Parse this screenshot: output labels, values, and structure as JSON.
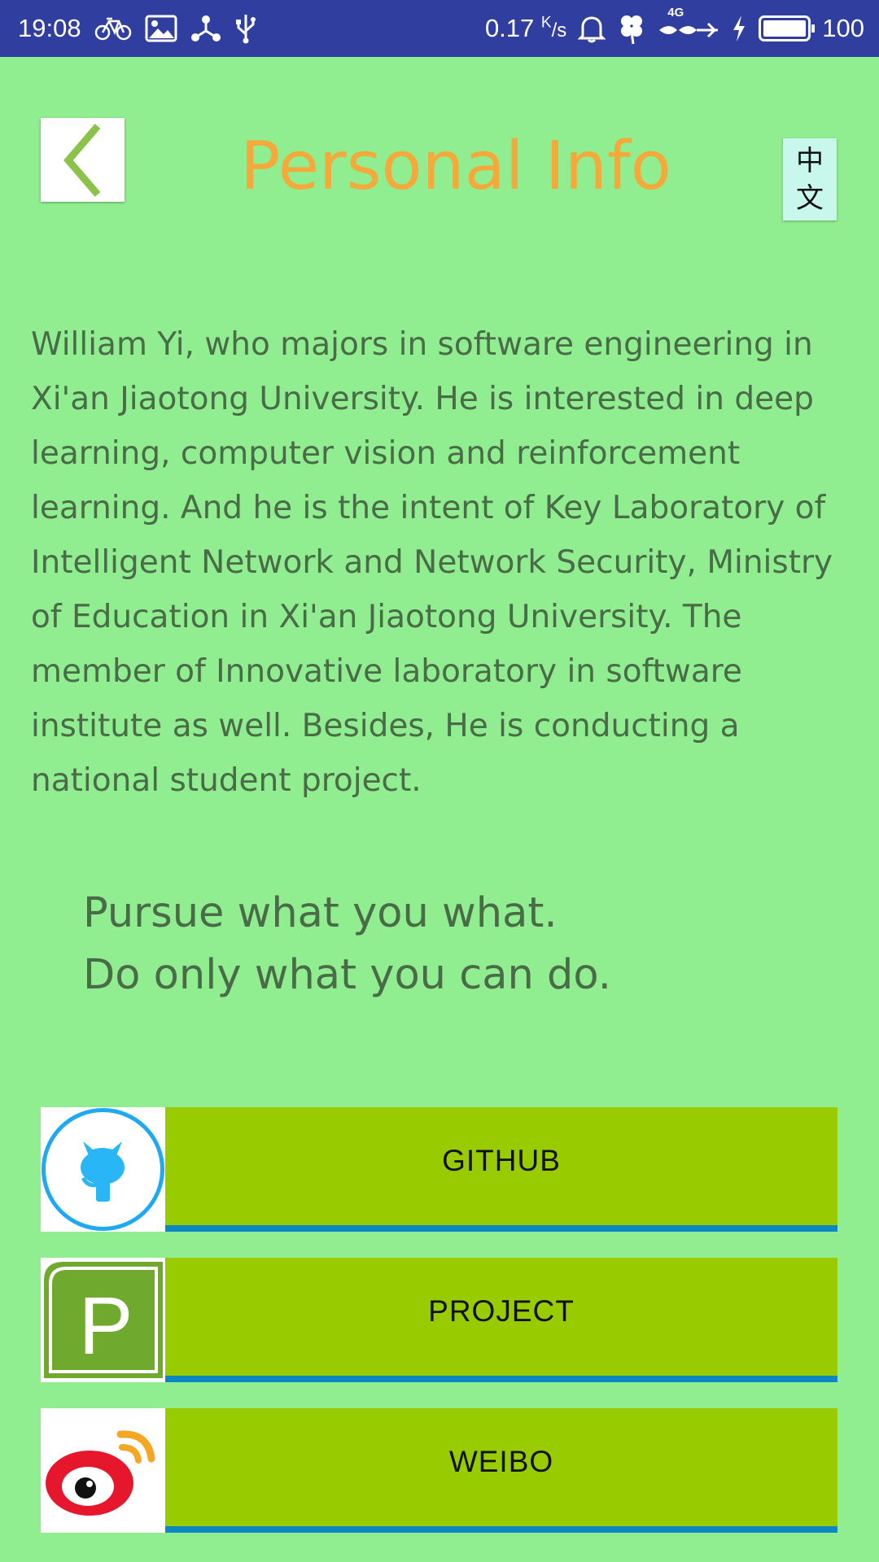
{
  "status_bar": {
    "time": "19:08",
    "net_speed": "0.17",
    "speed_unit_top": "K",
    "speed_unit_bottom": "/s",
    "network_type": "4G",
    "battery_level": "100"
  },
  "header": {
    "title": "Personal Info",
    "lang_char_1": "中",
    "lang_char_2": "文"
  },
  "bio": {
    "text": "William Yi, who majors in software engineering in Xi'an Jiaotong University. He is interested in deep learning, computer vision and reinforcement learning. And he is the intent of Key Laboratory of Intelligent Network and Network Security, Ministry of Education in Xi'an Jiaotong University. The member of Innovative laboratory in software institute as well. Besides, He is conducting a national student project."
  },
  "motto": {
    "line1": "Pursue what you what.",
    "line2": "Do only what you can do."
  },
  "links": [
    {
      "label": "GITHUB",
      "icon": "github-icon"
    },
    {
      "label": "PROJECT",
      "icon": "project-icon"
    },
    {
      "label": "WEIBO",
      "icon": "weibo-icon"
    }
  ],
  "colors": {
    "background": "#90ee90",
    "status_bar": "#303f9f",
    "title": "#f6a93b",
    "button": "#99cc00",
    "button_underline": "#0d87c1",
    "body_text": "#4a6b47"
  }
}
